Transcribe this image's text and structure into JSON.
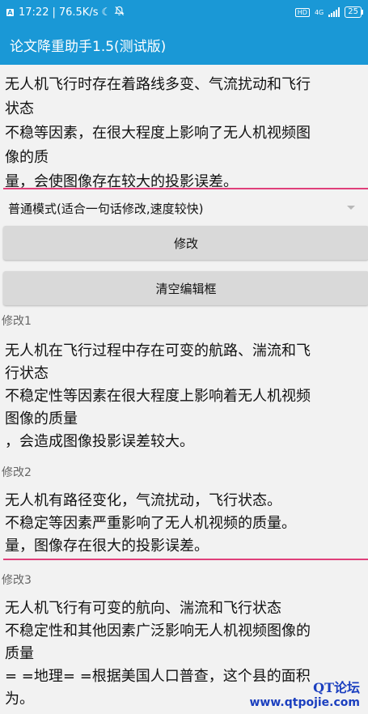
{
  "status_bar": {
    "time": "17:22",
    "network_speed": "76.5K/s",
    "network_type": "4G",
    "hd": "HD",
    "battery": "25"
  },
  "app": {
    "title": "论文降重助手1.5(测试版)"
  },
  "editor": {
    "lines": [
      "无人机飞行时存在着路线多变、气流扰动和飞行",
      "状态",
      "不稳等因素，在很大程度上影响了无人机视频图",
      "像的质",
      "量，会使图像存在较大的投影误差。"
    ]
  },
  "mode_select": {
    "selected": "普通模式(适合一句话修改,速度较快)"
  },
  "buttons": {
    "modify": "修改",
    "clear": "清空编辑框"
  },
  "results": [
    {
      "label": "修改1",
      "lines": [
        "无人机在飞行过程中存在可变的航路、湍流和飞",
        "行状态",
        "不稳定性等因素在很大程度上影响着无人机视频",
        "图像的质量",
        "，会造成图像投影误差较大。"
      ]
    },
    {
      "label": "修改2",
      "lines": [
        "无人机有路径变化，气流扰动，飞行状态。",
        "不稳定等因素严重影响了无人机视频的质量。",
        "量，图像存在很大的投影误差。"
      ]
    },
    {
      "label": "修改3",
      "lines": [
        "无人机飞行有可变的航向、湍流和飞行状态",
        "不稳定性和其他因素广泛影响无人机视频图像的",
        "质量",
        "= =地理= =根据美国人口普查，这个县的面积",
        "为。"
      ]
    }
  ],
  "watermark": {
    "top": "QT论坛",
    "bottom": "www.qtpojie.com"
  },
  "colors": {
    "primary": "#1a98d6",
    "accent_line": "#e0407a",
    "button_bg": "#d9d9d9",
    "background": "#f2f2f2"
  }
}
